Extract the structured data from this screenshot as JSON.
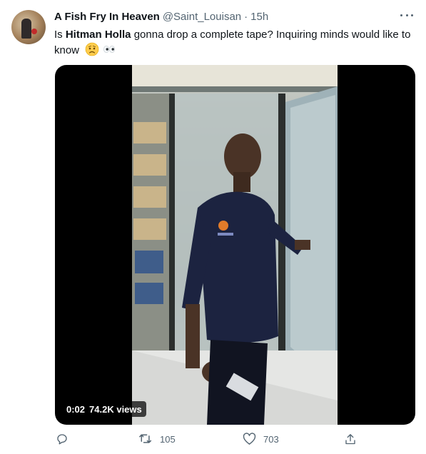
{
  "tweet": {
    "author_name": "A Fish Fry In Heaven",
    "handle": "@Saint_Louisan",
    "separator": "·",
    "time": "15h",
    "text_part1": "Is ",
    "text_bold": "Hitman Holla",
    "text_part2": " gonna drop a complete tape? Inquiring minds would like to know",
    "emojis": [
      "worried-face",
      "eyes"
    ]
  },
  "video": {
    "timestamp": "0:02",
    "views": "74.2K views"
  },
  "actions": {
    "retweets": "105",
    "likes": "703"
  },
  "colors": {
    "text_primary": "#0f1419",
    "text_secondary": "#536471",
    "media_bg": "#000000"
  }
}
